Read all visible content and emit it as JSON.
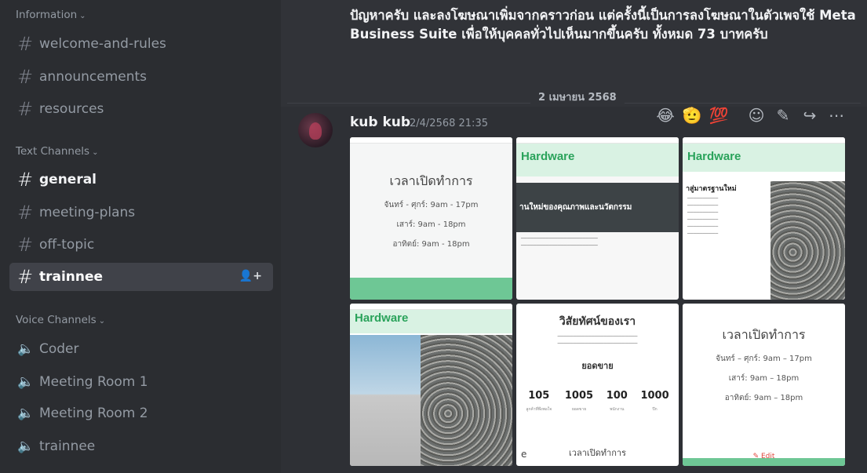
{
  "sidebar": {
    "categories": {
      "information": "Information",
      "text": "Text Channels",
      "voice": "Voice Channels"
    },
    "info_channels": [
      "welcome-and-rules",
      "announcements",
      "resources"
    ],
    "text_channels": [
      "general",
      "meeting-plans",
      "off-topic",
      "trainnee"
    ],
    "voice_channels": [
      "Coder",
      "Meeting Room 1",
      "Meeting Room 2",
      "trainnee"
    ]
  },
  "chat": {
    "prev_message": "ปัญหาครับ และลงโฆษณาเพิ่มจากคราวก่อน แต่ครั้งนี้เป็นการลงโฆษณาในตัวเพจใช้ Meta Business Suite เพื่อให้บุคคลทั่วไปเห็นมากขึ้นครับ ทั้งหมด 73 บาทครับ",
    "date_divider": "2 เมษายน 2568",
    "message": {
      "author": "kub kub",
      "timestamp": "2/4/2568 21:35"
    },
    "toolbar": {
      "reactions": [
        "😂",
        "🫡",
        "💯"
      ],
      "icons": [
        "add-reaction-icon",
        "pencil-icon",
        "forward-icon",
        "more-icon"
      ]
    }
  },
  "attachments": {
    "hours": {
      "title": "เวลาเปิดทำการ",
      "line1": "จันทร์ - ศุกร์: 9am - 17pm",
      "line2": "เสาร์: 9am - 18pm",
      "line3": "อาทิตย์: 9am - 18pm"
    },
    "brand": "Hardware",
    "dark_band": "านใหม่ของคุณภาพและนวัตกรรม",
    "standard_heading": "าสู่มาตรฐานใหม่",
    "vision_title": "วิสัยทัศน์ของเรา",
    "sales_title": "ยอดขาย",
    "stats": [
      {
        "n": "105",
        "l": "ลูกค้าที่พึงพอใจ"
      },
      {
        "n": "1005",
        "l": "ยอดขาย"
      },
      {
        "n": "100",
        "l": "พนักงาน"
      },
      {
        "n": "1000",
        "l": "ปีก"
      }
    ],
    "bottom_hours": "เวลาเปิดทำการ",
    "bottom_left_char": "e",
    "hours2": {
      "title": "เวลาเปิดทำการ",
      "line1": "จันทร์ – ศุกร์: 9am – 17pm",
      "line2": "เสาร์: 9am – 18pm",
      "line3": "อาทิตย์: 9am – 18pm"
    },
    "edit_label": "Edit",
    "colors": {
      "green": "#6ec795",
      "brand_green": "#2aa35b",
      "edit_red": "#e0463d"
    }
  }
}
